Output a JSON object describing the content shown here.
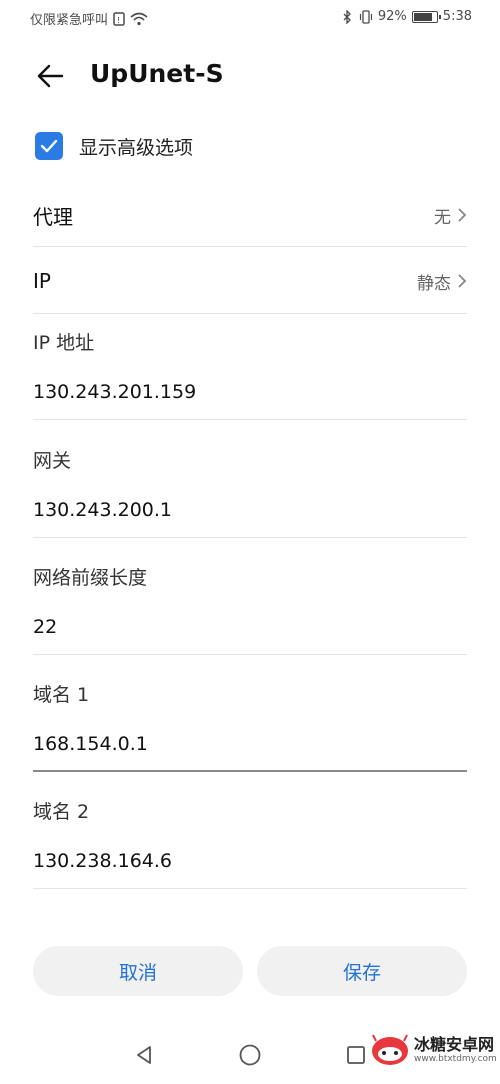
{
  "status_bar": {
    "carrier": "仅限紧急呼叫",
    "battery": "92%",
    "battery_level": 0.92,
    "time": "5:38"
  },
  "header": {
    "title": "UpUnet-S"
  },
  "advanced_option": {
    "label": "显示高级选项",
    "checked": true
  },
  "proxy": {
    "label": "代理",
    "value": "无"
  },
  "ip": {
    "label": "IP",
    "value": "静态"
  },
  "fields": {
    "ip_address": {
      "label": "IP 地址",
      "value": "130.243.201.159"
    },
    "gateway": {
      "label": "网关",
      "value": "130.243.200.1"
    },
    "prefix_length": {
      "label": "网络前缀长度",
      "value": "22"
    },
    "dns1": {
      "label": "域名 1",
      "value": "168.154.0.1"
    },
    "dns2": {
      "label": "域名 2",
      "value": "130.238.164.6"
    }
  },
  "buttons": {
    "cancel": "取消",
    "save": "保存"
  },
  "watermark": {
    "name": "冰糖安卓网",
    "url": "www.btxtdmy.com"
  },
  "colors": {
    "accent": "#2a7be4",
    "button_text": "#2272d8",
    "button_bg": "#f1f1f1"
  }
}
